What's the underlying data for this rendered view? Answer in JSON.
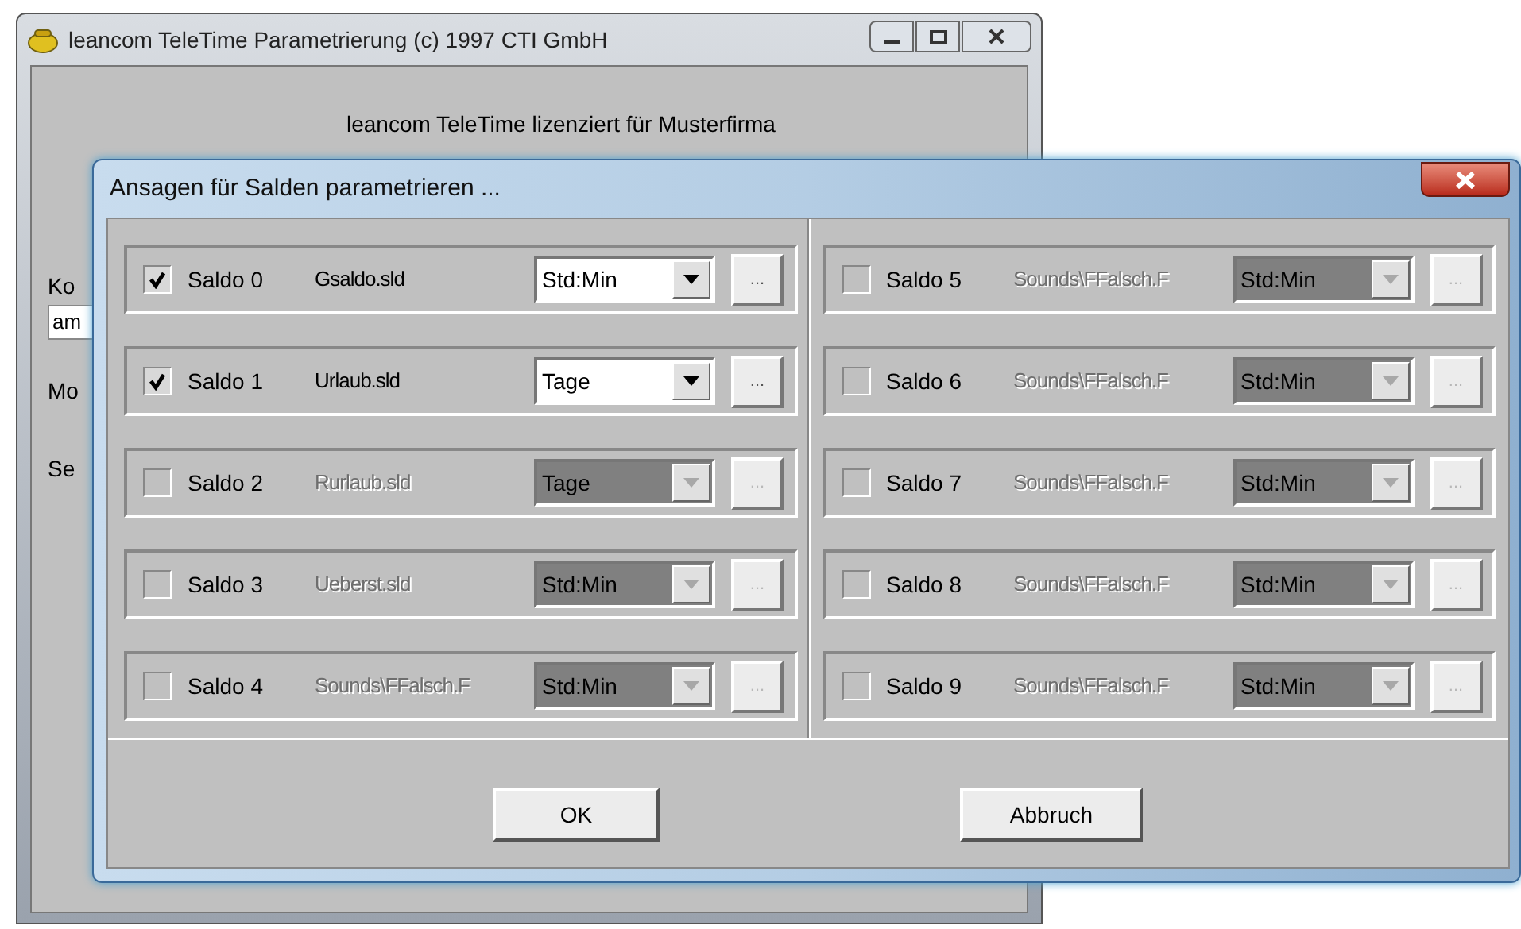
{
  "main_window": {
    "title": "leancom TeleTime Parametrierung (c) 1997 CTI GmbH",
    "license_text": "leancom TeleTime lizenziert für Musterfirma",
    "partial_labels": [
      "Ko",
      "Mo",
      "Se"
    ],
    "partial_field_value": "am"
  },
  "dialog": {
    "title": "Ansagen für Salden parametrieren ...",
    "columns": [
      [
        {
          "label": "Saldo 0",
          "file": "Gsaldo.sld",
          "unit": "Std:Min",
          "checked": true,
          "disabled": false
        },
        {
          "label": "Saldo 1",
          "file": "Urlaub.sld",
          "unit": "Tage",
          "checked": true,
          "disabled": false
        },
        {
          "label": "Saldo 2",
          "file": "Rurlaub.sld",
          "unit": "Tage",
          "checked": false,
          "disabled": true
        },
        {
          "label": "Saldo 3",
          "file": "Ueberst.sld",
          "unit": "Std:Min",
          "checked": false,
          "disabled": true
        },
        {
          "label": "Saldo 4",
          "file": "Sounds\\FFalsch.F",
          "unit": "Std:Min",
          "checked": false,
          "disabled": true
        }
      ],
      [
        {
          "label": "Saldo 5",
          "file": "Sounds\\FFalsch.F",
          "unit": "Std:Min",
          "checked": false,
          "disabled": true
        },
        {
          "label": "Saldo 6",
          "file": "Sounds\\FFalsch.F",
          "unit": "Std:Min",
          "checked": false,
          "disabled": true
        },
        {
          "label": "Saldo 7",
          "file": "Sounds\\FFalsch.F",
          "unit": "Std:Min",
          "checked": false,
          "disabled": true
        },
        {
          "label": "Saldo 8",
          "file": "Sounds\\FFalsch.F",
          "unit": "Std:Min",
          "checked": false,
          "disabled": true
        },
        {
          "label": "Saldo 9",
          "file": "Sounds\\FFalsch.F",
          "unit": "Std:Min",
          "checked": false,
          "disabled": true
        }
      ]
    ],
    "browse_label": "...",
    "buttons": [
      "OK",
      "Abbruch"
    ]
  }
}
